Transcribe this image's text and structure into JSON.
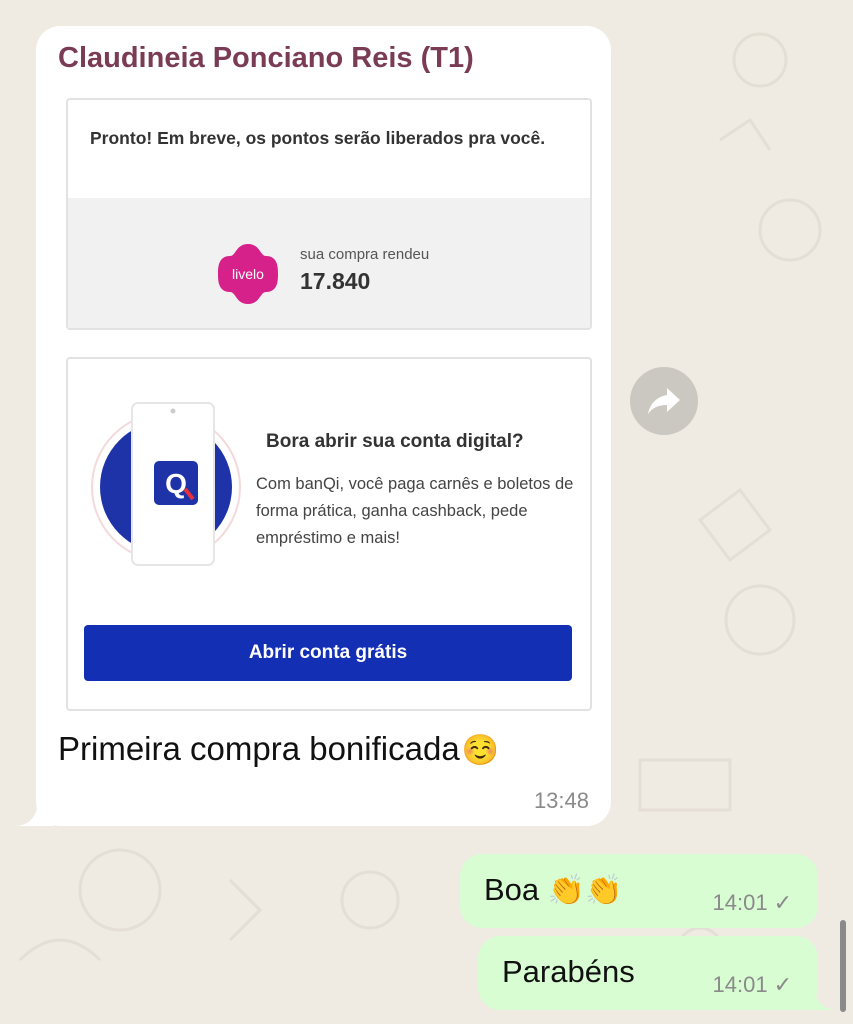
{
  "chat": {
    "incoming": {
      "sender": "Claudineia Ponciano Reis (T1)",
      "card_points": {
        "message": "Pronto! Em breve, os pontos serão liberados pra você.",
        "logo_text": "livelo",
        "label": "sua compra rendeu",
        "value": "17.840"
      },
      "card_bank": {
        "app_letter": "Q",
        "title": "Bora abrir sua conta digital?",
        "body": "Com banQi, você paga carnês e boletos de forma prática, ganha cashback, pede empréstimo e mais!",
        "button": "Abrir conta grátis"
      },
      "caption": "Primeira compra bonificada",
      "caption_emoji": "☺️",
      "time": "13:48"
    },
    "outgoing": [
      {
        "text": "Boa",
        "emoji": "👏👏",
        "time": "14:01",
        "status": "✓"
      },
      {
        "text": "Parabéns",
        "time": "14:01",
        "status": "✓"
      }
    ]
  },
  "colors": {
    "background": "#efeae2",
    "incoming_bubble": "#ffffff",
    "outgoing_bubble": "#d9fdd3",
    "sender_name": "#7a3b55",
    "livelo_pink": "#d6218a",
    "banqi_blue": "#1330b5"
  },
  "icons": {
    "forward": "forward-arrow-icon",
    "read_status": "check-icon"
  }
}
